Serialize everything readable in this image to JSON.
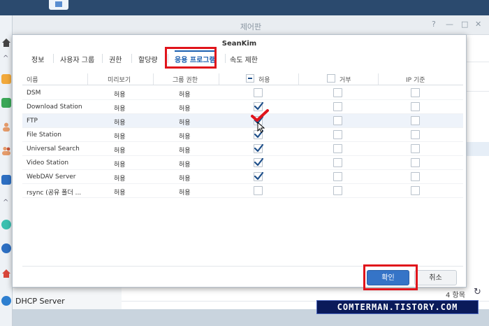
{
  "window": {
    "title": "제어판",
    "controls": [
      "?",
      "—",
      "□",
      "✕"
    ]
  },
  "background": {
    "count_text": "4 항목",
    "sidebar_item": "DHCP Server"
  },
  "dialog": {
    "title": "SeanKim",
    "tabs": [
      {
        "label": "정보"
      },
      {
        "label": "사용자 그룹"
      },
      {
        "label": "권한"
      },
      {
        "label": "할당량"
      },
      {
        "label": "응용 프로그램"
      },
      {
        "label": "속도 제한"
      }
    ],
    "active_tab": "응용 프로그램",
    "columns": [
      "이름",
      "미리보기",
      "그룹 권한",
      "허용",
      "거부",
      "IP 기준"
    ],
    "rows": [
      {
        "name": "DSM",
        "preview": "허용",
        "group": "허용",
        "allow": false,
        "deny": false,
        "ip": false
      },
      {
        "name": "Download Station",
        "preview": "허용",
        "group": "허용",
        "allow": true,
        "deny": false,
        "ip": false
      },
      {
        "name": "FTP",
        "preview": "허용",
        "group": "허용",
        "allow": true,
        "deny": false,
        "ip": false
      },
      {
        "name": "File Station",
        "preview": "허용",
        "group": "허용",
        "allow": true,
        "deny": false,
        "ip": false
      },
      {
        "name": "Universal Search",
        "preview": "허용",
        "group": "허용",
        "allow": true,
        "deny": false,
        "ip": false
      },
      {
        "name": "Video Station",
        "preview": "허용",
        "group": "허용",
        "allow": true,
        "deny": false,
        "ip": false
      },
      {
        "name": "WebDAV Server",
        "preview": "허용",
        "group": "허용",
        "allow": true,
        "deny": false,
        "ip": false
      },
      {
        "name": "rsync (공유 폴더 ...",
        "preview": "허용",
        "group": "허용",
        "allow": false,
        "deny": false,
        "ip": false
      }
    ],
    "ok_label": "확인",
    "cancel_label": "취소"
  },
  "watermark": "COMTERMAN.TISTORY.COM",
  "colors": {
    "accent": "#1b5fb0",
    "highlight": "#e0141b",
    "ok_button": "#3574c7"
  }
}
